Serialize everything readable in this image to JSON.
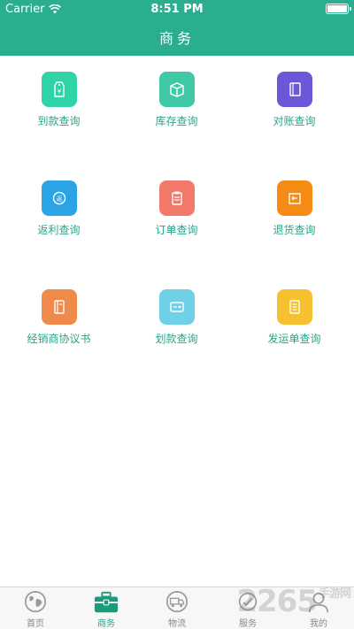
{
  "status_bar": {
    "carrier": "Carrier",
    "time": "8:51 PM"
  },
  "nav": {
    "title": "商务"
  },
  "colors": {
    "brand": "#2bad8f",
    "label": "#27a588",
    "tab_active": "#27a588",
    "tab_inactive": "#8a8a8a"
  },
  "grid": {
    "items": [
      {
        "label": "到款查询",
        "icon": "yuan-tag-icon",
        "color": "#2fd3a8"
      },
      {
        "label": "库存查询",
        "icon": "box-icon",
        "color": "#3fc9a7"
      },
      {
        "label": "对账查询",
        "icon": "notebook-icon",
        "color": "#6a58d8"
      },
      {
        "label": "返利查询",
        "icon": "rebate-icon",
        "color": "#2aa4e6"
      },
      {
        "label": "订单查询",
        "icon": "clipboard-icon",
        "color": "#f2786a"
      },
      {
        "label": "退货查询",
        "icon": "return-icon",
        "color": "#f58b14"
      },
      {
        "label": "经销商协议书",
        "icon": "agreement-icon",
        "color": "#f08a4b"
      },
      {
        "label": "划款查询",
        "icon": "card-icon",
        "color": "#6fd0e6"
      },
      {
        "label": "发运单查询",
        "icon": "document-icon",
        "color": "#f6c02e"
      }
    ]
  },
  "tabs": [
    {
      "label": "首页",
      "icon": "globe-icon",
      "active": false
    },
    {
      "label": "商务",
      "icon": "briefcase-icon",
      "active": true
    },
    {
      "label": "物流",
      "icon": "truck-icon",
      "active": false
    },
    {
      "label": "服务",
      "icon": "service-icon",
      "active": false
    },
    {
      "label": "我的",
      "icon": "person-icon",
      "active": false
    }
  ],
  "watermark": {
    "text": "2265",
    "suffix": "手游网"
  }
}
